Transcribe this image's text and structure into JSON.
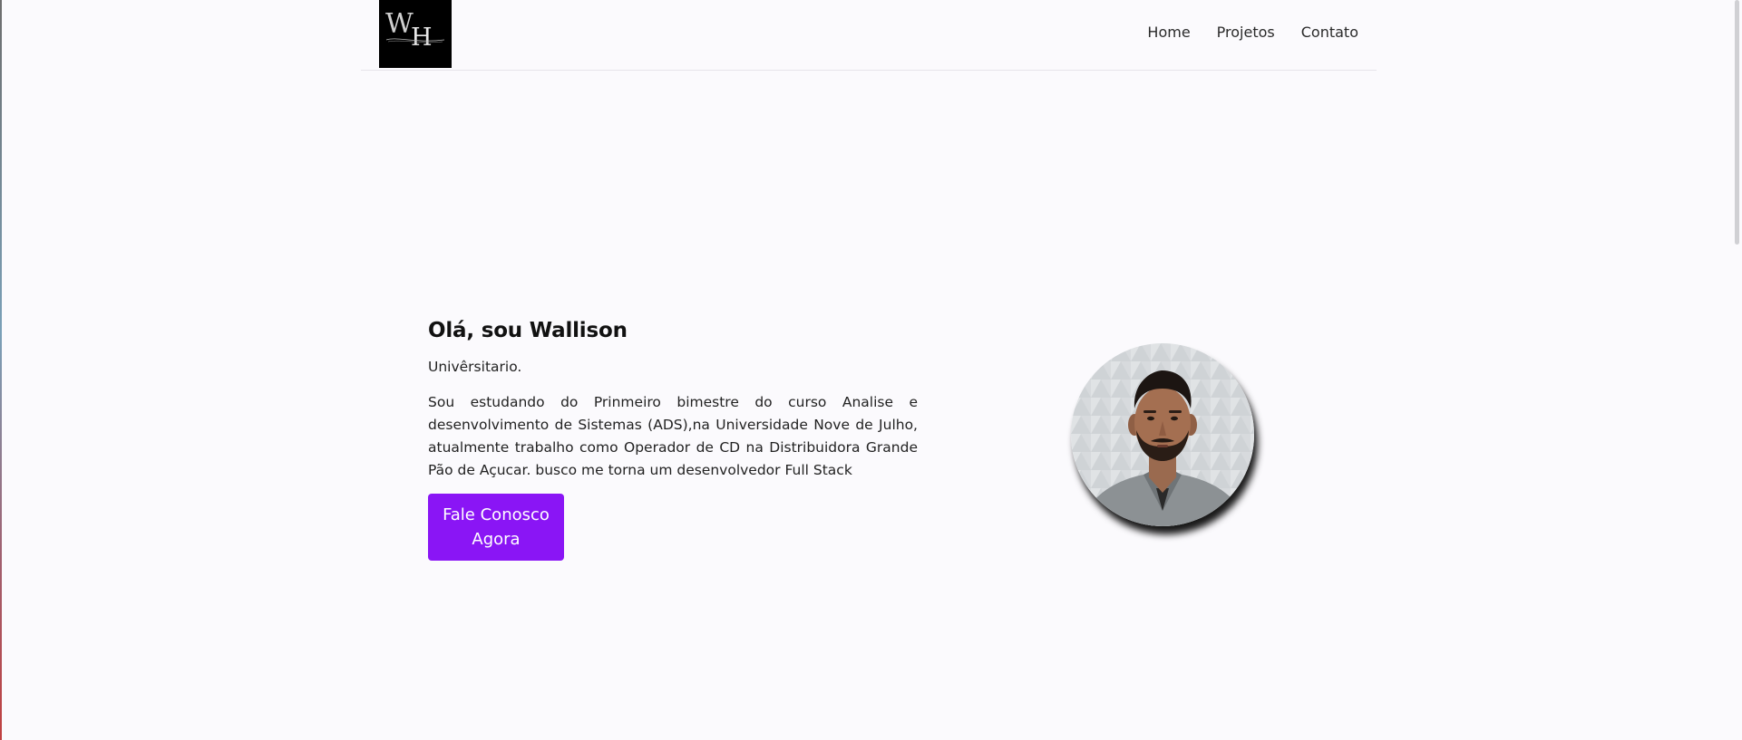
{
  "header": {
    "logo_alt": "WH Programming logo",
    "nav": {
      "home": "Home",
      "projects": "Projetos",
      "contact": "Contato"
    }
  },
  "hero": {
    "title": "Olá, sou Wallison",
    "subtitle": "Univêrsitario.",
    "description": "Sou estudando do Prinmeiro bimestre do curso Analise e desenvolvimento de Sistemas (ADS),na Universidade Nove de Julho, atualmente trabalho como Operador de CD na Distribuidora Grande Pão de Açucar. busco me torna um desenvolvedor Full Stack",
    "cta_label": "Fale Conosco Agora"
  },
  "colors": {
    "background": "#fbfafd",
    "accent": "#8a15f5",
    "logo_bg": "#000000"
  }
}
